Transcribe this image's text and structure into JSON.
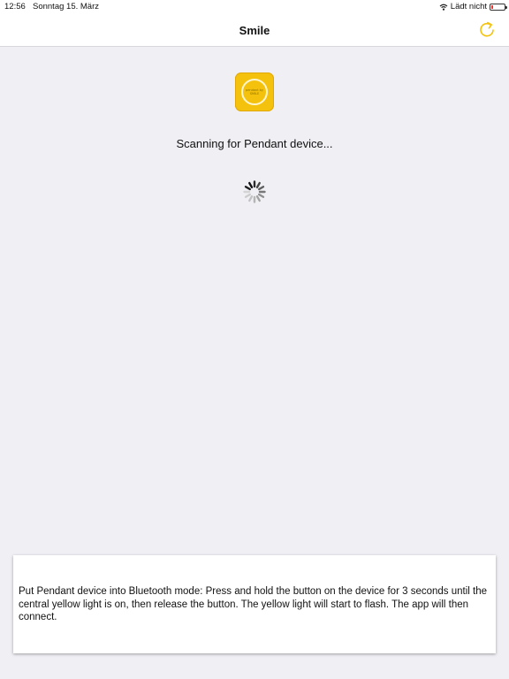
{
  "status_bar": {
    "time": "12:56",
    "date": "Sonntag 15. März",
    "charging_status": "Lädt nicht",
    "wifi_icon": "wifi-icon",
    "battery_icon": "battery-icon"
  },
  "nav": {
    "title": "Smile",
    "refresh_icon": "refresh-icon",
    "accent_color": "#f4c20d"
  },
  "logo": {
    "text": "pendant by SMILE"
  },
  "main": {
    "status_message": "Scanning for Pendant device...",
    "spinner_icon": "activity-spinner-icon"
  },
  "instructions": {
    "text": "Put Pendant device into Bluetooth mode: Press and hold the button on the device for 3 seconds until the central yellow light is on, then release the button. The yellow light will start to flash. The app will then connect."
  }
}
